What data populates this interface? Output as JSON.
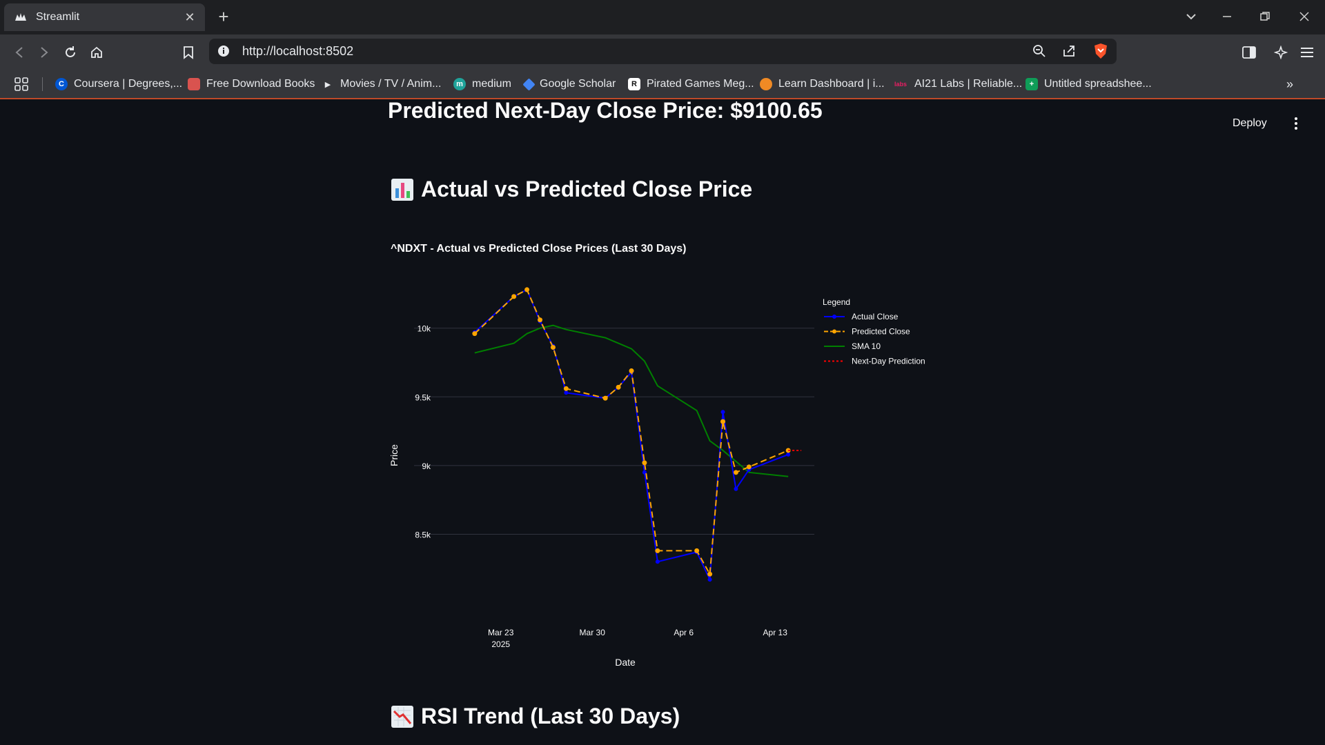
{
  "browser": {
    "tab_title": "Streamlit",
    "url": "http://localhost:8502",
    "bookmarks": [
      {
        "label": "Coursera | Degrees,...",
        "icon": "coursera-icon",
        "color": "#0056d2"
      },
      {
        "label": "Free Download Books",
        "icon": "book-icon",
        "color": "#d9534f"
      },
      {
        "label": "Movies / TV / Anim...",
        "icon": "play-icon",
        "color": "#e8eaed"
      },
      {
        "label": "medium",
        "icon": "medium-icon",
        "color": "#1fa39a"
      },
      {
        "label": "Google Scholar",
        "icon": "scholar-icon",
        "color": "#4285f4"
      },
      {
        "label": "Pirated Games Meg...",
        "icon": "r-icon",
        "color": "#ffffff"
      },
      {
        "label": "Learn Dashboard | i...",
        "icon": "learn-icon",
        "color": "#f08a24"
      },
      {
        "label": "AI21 Labs | Reliable...",
        "icon": "ai21-icon",
        "color": "#e91e63"
      },
      {
        "label": "Untitled spreadshee...",
        "icon": "sheets-icon",
        "color": "#0f9d58"
      }
    ]
  },
  "app": {
    "deploy_label": "Deploy",
    "clipped_heading": "Predicted Next-Day Close Price: $9100.65",
    "section1_title": "Actual vs Predicted Close Price",
    "section2_title": "RSI Trend (Last 30 Days)"
  },
  "chart_data": {
    "type": "line",
    "title": "^NDXT - Actual vs Predicted Close Prices (Last 30 Days)",
    "xlabel": "Date",
    "ylabel": "Price",
    "x_ticks": [
      "Mar 23\n2025",
      "Mar 30",
      "Apr 6",
      "Apr 13"
    ],
    "y_ticks": [
      "8.5k",
      "9k",
      "9.5k",
      "10k"
    ],
    "ylim": [
      7950,
      10370
    ],
    "legend_title": "Legend",
    "legend_position": "right",
    "x": [
      "2025-03-21",
      "2025-03-24",
      "2025-03-25",
      "2025-03-26",
      "2025-03-27",
      "2025-03-28",
      "2025-03-31",
      "2025-04-01",
      "2025-04-02",
      "2025-04-03",
      "2025-04-04",
      "2025-04-07",
      "2025-04-08",
      "2025-04-09",
      "2025-04-10",
      "2025-04-11",
      "2025-04-14"
    ],
    "series": [
      {
        "name": "Actual Close",
        "color": "#0000ff",
        "style": "solid",
        "markers": true,
        "values": [
          9970,
          10230,
          10280,
          10050,
          9870,
          9530,
          9490,
          9570,
          9680,
          8950,
          8300,
          8370,
          8170,
          9390,
          8830,
          8970,
          9080
        ]
      },
      {
        "name": "Predicted Close",
        "color": "#ffa500",
        "style": "dash",
        "markers": true,
        "values": [
          9960,
          10230,
          10280,
          10060,
          9860,
          9560,
          9490,
          9570,
          9690,
          9020,
          8380,
          8380,
          8210,
          9320,
          8950,
          8990,
          9110
        ]
      },
      {
        "name": "SMA 10",
        "color": "#008000",
        "style": "solid",
        "markers": false,
        "values": [
          9820,
          9890,
          9960,
          10000,
          10020,
          9990,
          9930,
          9890,
          9850,
          9760,
          9580,
          9400,
          9180,
          9110,
          9030,
          8950,
          8920
        ]
      },
      {
        "name": "Next-Day Prediction",
        "color": "#ff0000",
        "style": "dot",
        "markers": false,
        "x": [
          "2025-04-14",
          "2025-04-15"
        ],
        "values": [
          9110,
          9110
        ]
      }
    ]
  }
}
